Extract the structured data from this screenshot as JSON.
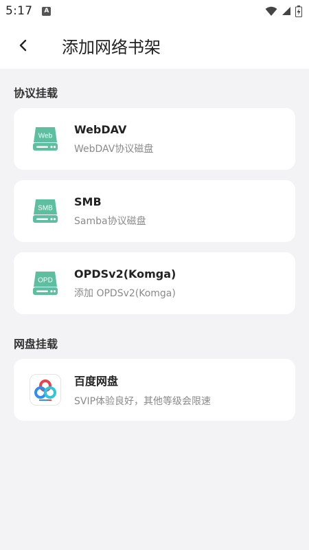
{
  "status_bar": {
    "time": "5:17",
    "notification_icon": "A",
    "icons": [
      "wifi-icon",
      "signal-icon",
      "battery-icon"
    ]
  },
  "app_bar": {
    "title": "添加网络书架",
    "back_icon": "chevron-left-icon"
  },
  "sections": [
    {
      "header": "协议挂载",
      "items": [
        {
          "title": "WebDAV",
          "subtitle": "WebDAV协议磁盘",
          "icon_label": "Web",
          "icon": "drive-icon"
        },
        {
          "title": "SMB",
          "subtitle": "Samba协议磁盘",
          "icon_label": "SMB",
          "icon": "drive-icon"
        },
        {
          "title": "OPDSv2(Komga)",
          "subtitle": "添加 OPDSv2(Komga)",
          "icon_label": "OPD",
          "icon": "drive-icon"
        }
      ]
    },
    {
      "header": "网盘挂载",
      "items": [
        {
          "title": "百度网盘",
          "subtitle": "SVIP体验良好，其他等级会限速",
          "icon": "baidu-netdisk-icon"
        }
      ]
    }
  ],
  "colors": {
    "background": "#f3f3f5",
    "card": "#ffffff",
    "drive_accent": "#5dbf9f",
    "baidu_blue": "#2f8ff0",
    "baidu_red": "#e8434c",
    "baidu_cyan": "#30c5d8"
  }
}
